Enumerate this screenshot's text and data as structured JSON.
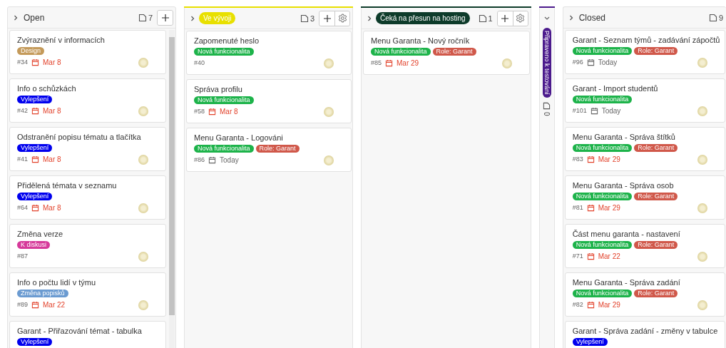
{
  "columns": [
    {
      "kind": "expanded",
      "title": "Open",
      "count": "7",
      "add": true,
      "settings": false,
      "cards": [
        {
          "title": "Zvýraznění v informacích",
          "tags": [
            {
              "label": "Design",
              "color": "#c49a5a"
            }
          ],
          "number": "#34",
          "due": {
            "text": "Mar 8",
            "overdue": true
          }
        },
        {
          "title": "Info o schůzkách",
          "tags": [
            {
              "label": "Vylepšení",
              "color": "#0000ee"
            }
          ],
          "number": "#42",
          "due": {
            "text": "Mar 8",
            "overdue": true
          }
        },
        {
          "title": "Odstranění popisu tématu a tlačítka",
          "tags": [
            {
              "label": "Vylepšení",
              "color": "#0000ee"
            }
          ],
          "number": "#41",
          "due": {
            "text": "Mar 8",
            "overdue": true
          }
        },
        {
          "title": "Přidělená témata v seznamu",
          "tags": [
            {
              "label": "Vylepšení",
              "color": "#0000ee"
            }
          ],
          "number": "#64",
          "due": {
            "text": "Mar 8",
            "overdue": true
          }
        },
        {
          "title": "Změna verze",
          "tags": [
            {
              "label": "K diskusi",
              "color": "#d63a9a"
            }
          ],
          "number": "#87"
        },
        {
          "title": "Info o počtu lidí v týmu",
          "tags": [
            {
              "label": "Změna popisků",
              "color": "#6b9bd1"
            }
          ],
          "number": "#89",
          "due": {
            "text": "Mar 22",
            "overdue": true
          }
        },
        {
          "title": "Garant - Přiřazování témat - tabulka",
          "tags": [
            {
              "label": "Vylepšení",
              "color": "#0000ee"
            }
          ]
        }
      ]
    },
    {
      "kind": "expanded",
      "title": "Ve vývoji",
      "color": "#e8e000",
      "count": "3",
      "add": true,
      "settings": true,
      "cards": [
        {
          "title": "Zapomenuté heslo",
          "tags": [
            {
              "label": "Nová funkcionalita",
              "color": "#1db34a"
            }
          ],
          "number": "#40"
        },
        {
          "title": "Správa profilu",
          "tags": [
            {
              "label": "Nová funkcionalita",
              "color": "#1db34a"
            }
          ],
          "number": "#58",
          "due": {
            "text": "Mar 8",
            "overdue": true
          }
        },
        {
          "title": "Menu Garanta - Logováni",
          "tags": [
            {
              "label": "Nová funkcionalita",
              "color": "#1db34a"
            },
            {
              "label": "Role: Garant",
              "color": "#d0584a"
            }
          ],
          "number": "#86",
          "due": {
            "text": "Today",
            "overdue": false
          }
        }
      ]
    },
    {
      "kind": "expanded",
      "title": "Čeká na přesun na hosting",
      "color": "#0d3b2a",
      "count": "1",
      "add": true,
      "settings": true,
      "cards": [
        {
          "title": "Menu Garanta - Nový ročník",
          "tags": [
            {
              "label": "Nová funkcionalita",
              "color": "#1db34a"
            },
            {
              "label": "Role: Garant",
              "color": "#d0584a"
            }
          ],
          "number": "#85",
          "due": {
            "text": "Mar 29",
            "overdue": true
          }
        }
      ]
    },
    {
      "kind": "collapsed",
      "title": "Připraveno k testování",
      "color": "#4b1a8c",
      "count": "0"
    },
    {
      "kind": "expanded",
      "title": "Closed",
      "count": "9",
      "add": false,
      "settings": false,
      "cards": [
        {
          "title": "Garant - Seznam týmů - zadávání zápočtů",
          "tags": [
            {
              "label": "Nová funkcionalita",
              "color": "#1db34a"
            },
            {
              "label": "Role: Garant",
              "color": "#d0584a"
            }
          ],
          "number": "#96",
          "due": {
            "text": "Today",
            "overdue": false
          }
        },
        {
          "title": "Garant - Import studentů",
          "tags": [
            {
              "label": "Nová funkcionalita",
              "color": "#1db34a"
            }
          ],
          "number": "#101",
          "due": {
            "text": "Today",
            "overdue": false
          }
        },
        {
          "title": "Menu Garanta - Správa štítků",
          "tags": [
            {
              "label": "Nová funkcionalita",
              "color": "#1db34a"
            },
            {
              "label": "Role: Garant",
              "color": "#d0584a"
            }
          ],
          "number": "#83",
          "due": {
            "text": "Mar 29",
            "overdue": true
          }
        },
        {
          "title": "Menu Garanta - Správa osob",
          "tags": [
            {
              "label": "Nová funkcionalita",
              "color": "#1db34a"
            },
            {
              "label": "Role: Garant",
              "color": "#d0584a"
            }
          ],
          "number": "#81",
          "due": {
            "text": "Mar 29",
            "overdue": true
          }
        },
        {
          "title": "Část menu garanta - nastavení",
          "tags": [
            {
              "label": "Nová funkcionalita",
              "color": "#1db34a"
            },
            {
              "label": "Role: Garant",
              "color": "#d0584a"
            }
          ],
          "number": "#71",
          "due": {
            "text": "Mar 22",
            "overdue": true
          }
        },
        {
          "title": "Menu Garanta - Správa zadání",
          "tags": [
            {
              "label": "Nová funkcionalita",
              "color": "#1db34a"
            },
            {
              "label": "Role: Garant",
              "color": "#d0584a"
            }
          ],
          "number": "#82",
          "due": {
            "text": "Mar 29",
            "overdue": true
          }
        },
        {
          "title": "Garant - Správa zadání - změny v tabulce",
          "tags": [
            {
              "label": "Vylepšení",
              "color": "#0000ee"
            }
          ]
        }
      ]
    }
  ]
}
